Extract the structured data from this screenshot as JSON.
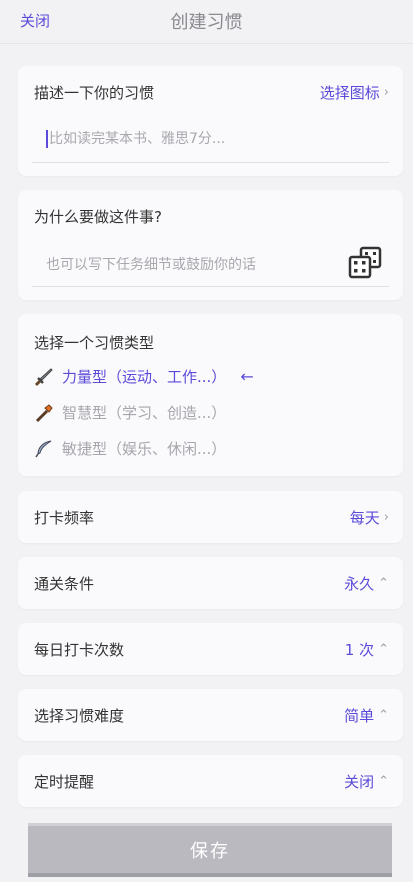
{
  "header": {
    "close_label": "关闭",
    "title": "创建习惯"
  },
  "describe": {
    "label": "描述一下你的习惯",
    "choose_icon": "选择图标",
    "placeholder": "比如读完某本书、雅思7分..."
  },
  "why": {
    "label": "为什么要做这件事?",
    "placeholder": "也可以写下任务细节或鼓励你的话"
  },
  "habit_type": {
    "label": "选择一个习惯类型",
    "options": [
      {
        "label": "力量型（运动、工作...）",
        "icon": "sword-icon",
        "selected": true
      },
      {
        "label": "智慧型（学习、创造...）",
        "icon": "staff-icon",
        "selected": false
      },
      {
        "label": "敏捷型（娱乐、休闲...）",
        "icon": "feather-icon",
        "selected": false
      }
    ]
  },
  "frequency": {
    "label": "打卡频率",
    "value": "每天"
  },
  "completion": {
    "label": "通关条件",
    "value": "永久"
  },
  "daily_count": {
    "label": "每日打卡次数",
    "value": "1 次"
  },
  "difficulty": {
    "label": "选择习惯难度",
    "value": "简单"
  },
  "reminder": {
    "label": "定时提醒",
    "value": "关闭"
  },
  "save_label": "保存",
  "colors": {
    "accent": "#5b4bd8",
    "background": "#f2f2f5",
    "card": "#fafafc",
    "button": "#b9b9bf"
  }
}
